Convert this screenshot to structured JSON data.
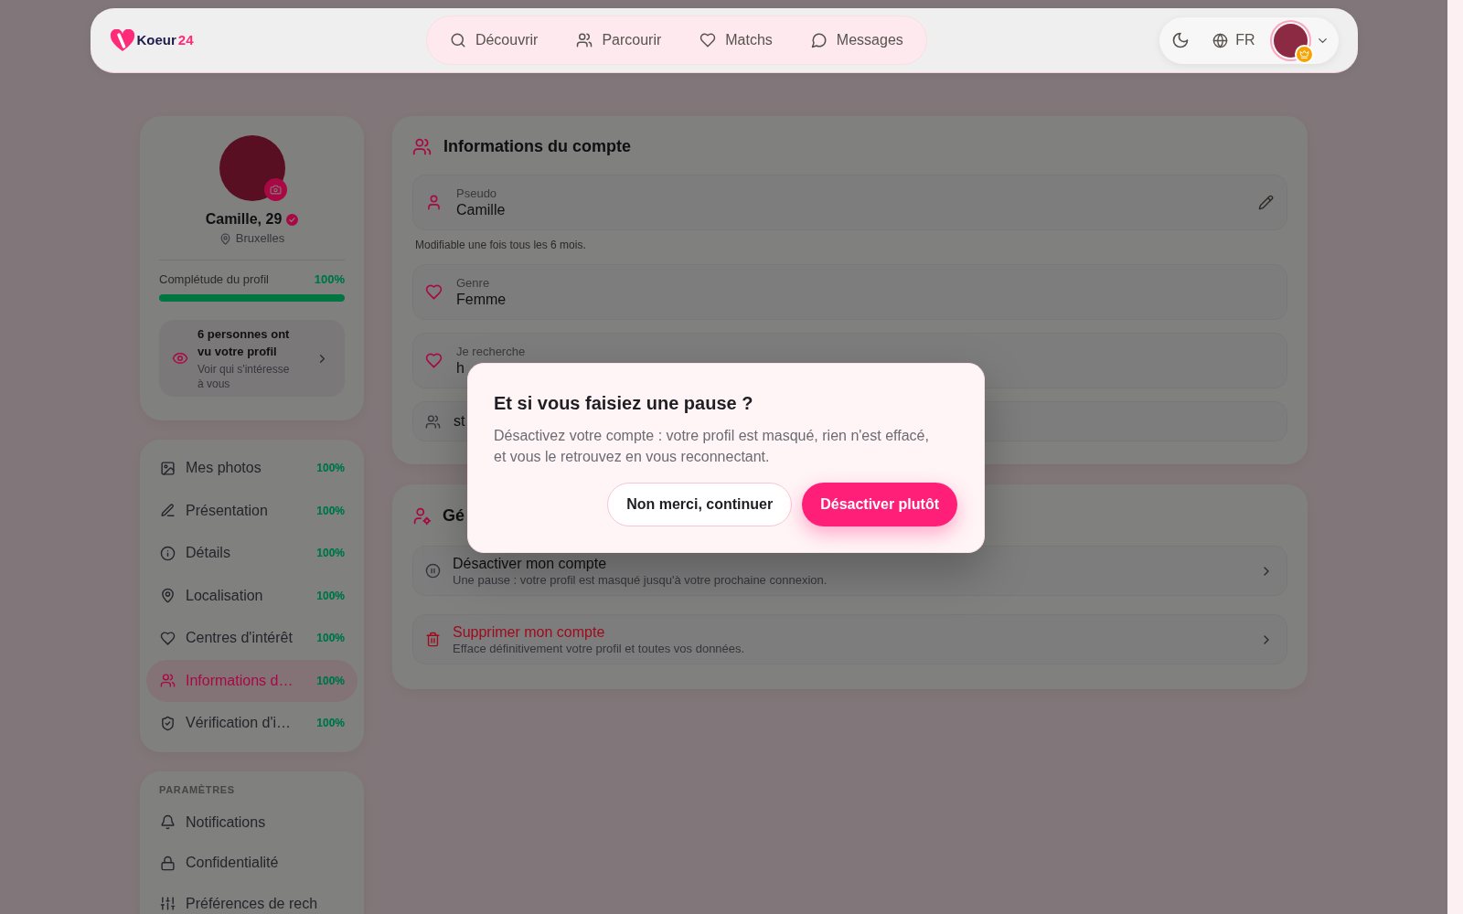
{
  "nav": {
    "logo": {
      "text": "Koeur",
      "accent": "24"
    },
    "links": [
      {
        "label": "Découvrir"
      },
      {
        "label": "Parcourir"
      },
      {
        "label": "Matchs"
      },
      {
        "label": "Messages"
      }
    ],
    "language": "FR",
    "account": {
      "premium": true
    }
  },
  "profile": {
    "name": "Camille, 29",
    "verified": true,
    "city": "Bruxelles",
    "completion": {
      "label": "Complétude du profil",
      "value": "100%",
      "level": 1
    },
    "views": {
      "title": "6 personnes ont vu votre profil",
      "subtitle": "Voir qui s'intéresse à vous"
    }
  },
  "sidebar": {
    "sections": [
      {
        "items": [
          {
            "label": "Mes photos",
            "value": "100%",
            "selected": false
          },
          {
            "label": "Présentation",
            "value": "100%",
            "selected": false
          },
          {
            "label": "Détails",
            "value": "100%",
            "selected": false
          },
          {
            "label": "Localisation",
            "value": "100%",
            "selected": false
          },
          {
            "label": "Centres d'intérêt",
            "value": "100%",
            "selected": false
          },
          {
            "label": "Informations d…",
            "value": "100%",
            "selected": true
          },
          {
            "label": "Vérification d'i…",
            "value": "100%",
            "selected": false
          }
        ]
      },
      {
        "heading": "PARAMÈTRES",
        "items": [
          {
            "label": "Notifications",
            "selected": false
          },
          {
            "label": "Confidentialité",
            "selected": false
          },
          {
            "label": "Préférences de rech",
            "selected": false
          }
        ]
      }
    ]
  },
  "account_info": {
    "title": "Informations du compte",
    "fields": [
      {
        "kind": "labeled",
        "label": "Pseudo",
        "value": "Camille",
        "editable": true,
        "hint": "Modifiable une fois tous les 6 mois."
      },
      {
        "kind": "labeled",
        "label": "Genre",
        "value": "Femme",
        "editable": false
      },
      {
        "kind": "labeled",
        "label": "Je recherche",
        "value": "h",
        "editable": false
      },
      {
        "kind": "plain",
        "value": "st",
        "editable": false
      }
    ]
  },
  "account_management": {
    "title": "Gé",
    "actions": [
      {
        "title": "Désactiver mon compte",
        "description": "Une pause : votre profil est masqué jusqu'à votre prochaine connexion.",
        "danger": false
      },
      {
        "title": "Supprimer mon compte",
        "description": "Efface définitivement votre profil et toutes vos données.",
        "danger": true
      }
    ]
  },
  "dialog": {
    "title": "Et si vous faisiez une pause ?",
    "message": "Désactivez votre compte : votre profil est masqué, rien n'est effacé, et vous le retrouvez en vous reconnectant.",
    "buttons": [
      {
        "label": "Non merci, continuer",
        "kind": "secondary"
      },
      {
        "label": "Désactiver plutôt",
        "kind": "primary"
      }
    ]
  }
}
